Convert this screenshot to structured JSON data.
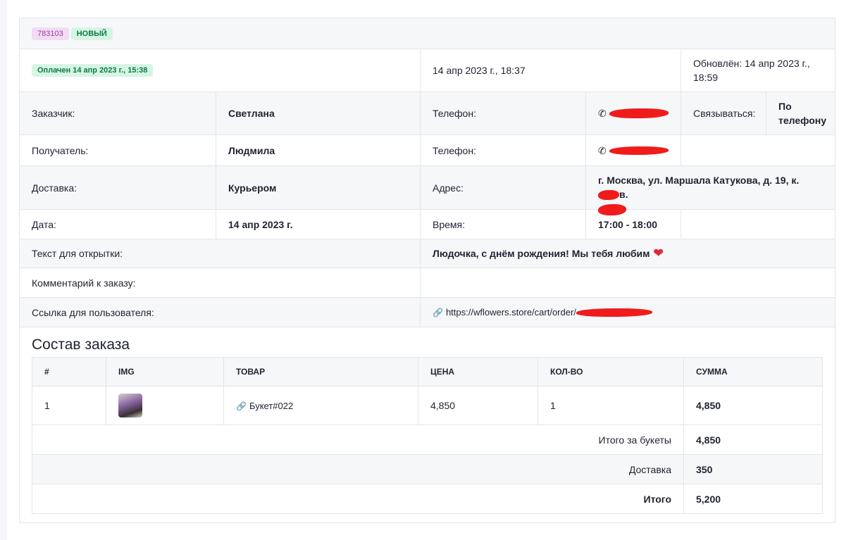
{
  "order": {
    "id": "783103",
    "status": "НОВЫЙ",
    "paid_badge": "Оплачен 14 апр 2023 г., 15:38",
    "created": "14 апр 2023 г., 18:37",
    "updated": "Обновлён: 14 апр 2023 г., 18:59"
  },
  "details": {
    "customer_label": "Заказчик:",
    "customer_value": "Светлана",
    "phone_label": "Телефон:",
    "contact_label": "Связываться:",
    "contact_value": "По телефону",
    "recipient_label": "Получатель:",
    "recipient_value": "Людмила",
    "delivery_label": "Доставка:",
    "delivery_value": "Курьером",
    "address_label": "Адрес:",
    "address_value": "г. Москва, ул. Маршала Катукова, д. 19, к.",
    "address_tail": "в.",
    "date_label": "Дата:",
    "date_value": "14 апр 2023 г.",
    "time_label": "Время:",
    "time_value": "17:00 - 18:00",
    "card_text_label": "Текст для открытки:",
    "card_text_value": "Людочка, с днём рождения! Мы тебя любим",
    "comment_label": "Комментарий к заказу:",
    "comment_value": "",
    "link_label": "Ссылка для пользователя:",
    "link_value": "https://wflowers.store/cart/order/"
  },
  "composition": {
    "title": "Состав заказа",
    "headers": [
      "#",
      "IMG",
      "ТОВАР",
      "ЦЕНА",
      "КОЛ-ВО",
      "СУММА"
    ],
    "items": [
      {
        "num": "1",
        "name": "Букет#022",
        "price": "4,850",
        "qty": "1",
        "sum": "4,850"
      }
    ],
    "totals": [
      {
        "label": "Итого за букеты",
        "value": "4,850"
      },
      {
        "label": "Доставка",
        "value": "350"
      },
      {
        "label": "Итого",
        "value": "5,200"
      }
    ]
  },
  "colors": {
    "accent_green": "#0e7a44",
    "badge_purple": "#9b3aa2",
    "redaction": "#f01b1b"
  }
}
